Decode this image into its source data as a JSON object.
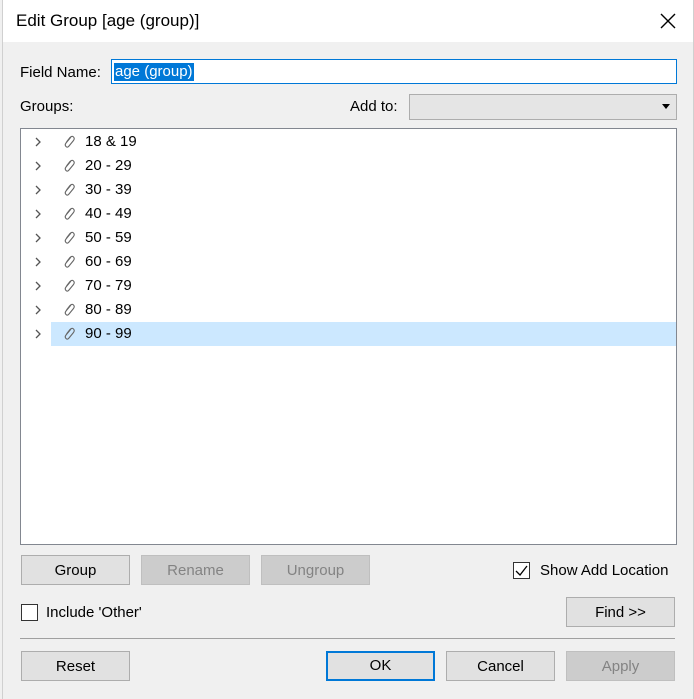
{
  "window": {
    "title": "Edit Group [age (group)]"
  },
  "field_name": {
    "label": "Field Name:",
    "value": "age (group)"
  },
  "groups_label": "Groups:",
  "add_to": {
    "label": "Add to:",
    "value": ""
  },
  "groups": [
    {
      "label": "18 & 19",
      "selected": false
    },
    {
      "label": "20 - 29",
      "selected": false
    },
    {
      "label": "30 - 39",
      "selected": false
    },
    {
      "label": "40 - 49",
      "selected": false
    },
    {
      "label": "50 - 59",
      "selected": false
    },
    {
      "label": "60 - 69",
      "selected": false
    },
    {
      "label": "70 - 79",
      "selected": false
    },
    {
      "label": "80 - 89",
      "selected": false
    },
    {
      "label": "90 - 99",
      "selected": true
    }
  ],
  "buttons": {
    "group": "Group",
    "rename": "Rename",
    "ungroup": "Ungroup",
    "find": "Find >>",
    "reset": "Reset",
    "ok": "OK",
    "cancel": "Cancel",
    "apply": "Apply"
  },
  "show_add_location": {
    "label": "Show Add Location",
    "checked": true
  },
  "include_other": {
    "label": "Include 'Other'",
    "checked": false
  },
  "colors": {
    "accent": "#0078d7",
    "selection": "#cce8ff",
    "background": "#f0f0f0"
  }
}
